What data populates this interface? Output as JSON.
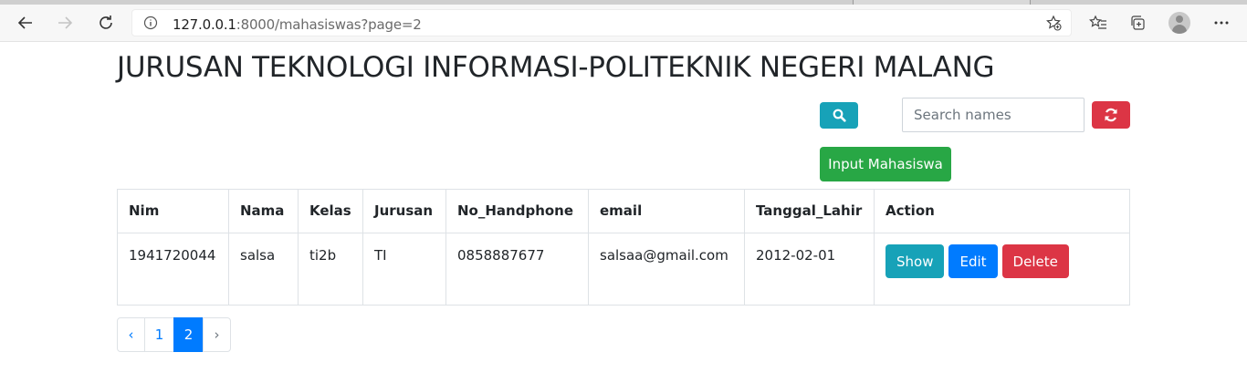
{
  "browser": {
    "url_host": "127.0.0.1",
    "url_rest": ":8000/mahasiswas?page=2",
    "icons": [
      "back-icon",
      "forward-icon",
      "reload-icon",
      "info-icon",
      "favorite-add-icon",
      "favorites-icon",
      "collections-icon",
      "profile-icon",
      "more-icon"
    ]
  },
  "page": {
    "title": "JURUSAN TEKNOLOGI INFORMASI-POLITEKNIK NEGERI MALANG"
  },
  "search": {
    "placeholder": "Search names",
    "value": ""
  },
  "actions": {
    "input_label": "Input Mahasiswa"
  },
  "table": {
    "headers": [
      "Nim",
      "Nama",
      "Kelas",
      "Jurusan",
      "No_Handphone",
      "email",
      "Tanggal_Lahir",
      "Action"
    ],
    "rows": [
      {
        "nim": "1941720044",
        "nama": "salsa",
        "kelas": "ti2b",
        "jurusan": "TI",
        "no_handphone": "0858887677",
        "email": "salsaa@gmail.com",
        "tanggal_lahir": "2012-02-01",
        "show_label": "Show",
        "edit_label": "Edit",
        "delete_label": "Delete"
      }
    ]
  },
  "pagination": {
    "prev": "‹",
    "pages": [
      "1",
      "2"
    ],
    "active_page": "2",
    "next": "›"
  },
  "colors": {
    "info": "#17a2b8",
    "danger": "#dc3545",
    "success": "#28a745",
    "primary": "#007bff"
  }
}
